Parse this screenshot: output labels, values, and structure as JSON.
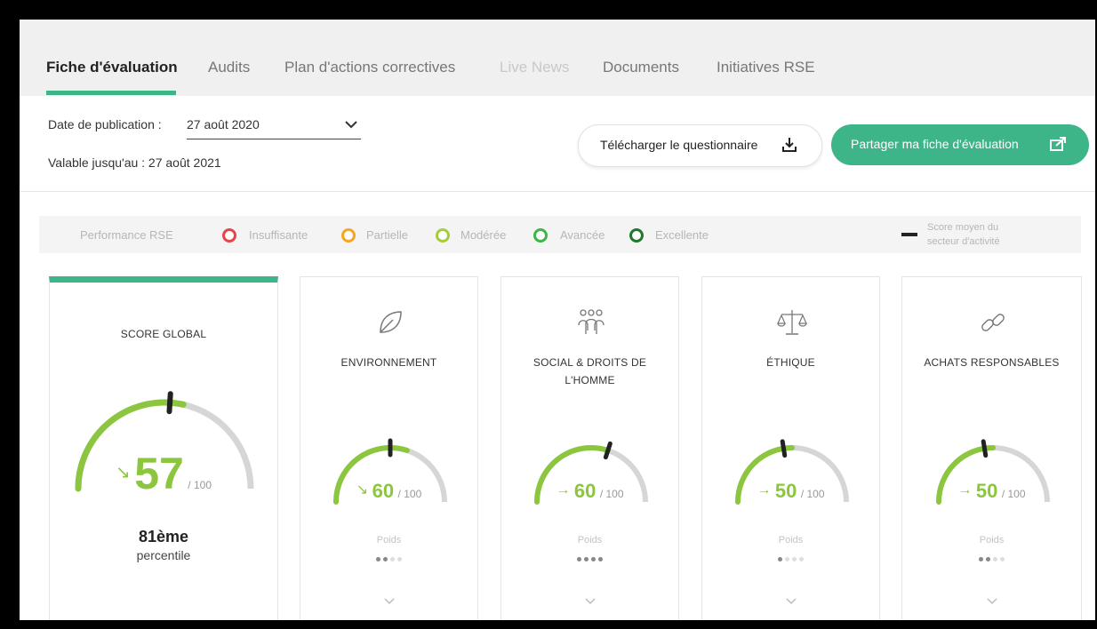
{
  "tabs": [
    {
      "label": "Fiche d'évaluation",
      "state": "active"
    },
    {
      "label": "Audits",
      "state": "normal"
    },
    {
      "label": "Plan d'actions correctives",
      "state": "normal"
    },
    {
      "label": "Live News",
      "state": "disabled"
    },
    {
      "label": "Documents",
      "state": "normal"
    },
    {
      "label": "Initiatives RSE",
      "state": "normal"
    }
  ],
  "publication": {
    "label": "Date de publication :",
    "value": "27 août 2020",
    "valid_until": "Valable jusqu'au : 27 août 2021"
  },
  "actions": {
    "download_label": "Télécharger le questionnaire",
    "share_label": "Partager ma fiche d'évaluation"
  },
  "legend": {
    "title": "Performance RSE",
    "levels": [
      {
        "label": "Insuffisante",
        "color": "#e8434b"
      },
      {
        "label": "Partielle",
        "color": "#f5a623"
      },
      {
        "label": "Modérée",
        "color": "#a4cd39"
      },
      {
        "label": "Avancée",
        "color": "#3eb449"
      },
      {
        "label": "Excellente",
        "color": "#1f7a2e"
      }
    ],
    "average_line1": "Score moyen du",
    "average_line2": "secteur d'activité"
  },
  "colors": {
    "accent": "#3eb489",
    "gauge_fill": "#8cc63f",
    "gauge_track": "#d6d6d6"
  },
  "global": {
    "title": "SCORE GLOBAL",
    "score": "57",
    "max": "/ 100",
    "trend": "↘",
    "sector_average": 52,
    "percentile_value": "81ème",
    "percentile_label": "percentile"
  },
  "categories": [
    {
      "title_line1": "ENVIRONNEMENT",
      "title_line2": "",
      "icon": "leaf-icon",
      "score": "60",
      "max": "/ 100",
      "trend": "↘",
      "sector_average": 50,
      "poids_label": "Poids",
      "weight": 2
    },
    {
      "title_line1": "SOCIAL & DROITS DE",
      "title_line2": "L'HOMME",
      "icon": "people-icon",
      "score": "60",
      "max": "/ 100",
      "trend": "→",
      "sector_average": 60,
      "poids_label": "Poids",
      "weight": 4
    },
    {
      "title_line1": "ÉTHIQUE",
      "title_line2": "",
      "icon": "scales-icon",
      "score": "50",
      "max": "/ 100",
      "trend": "→",
      "sector_average": 45,
      "poids_label": "Poids",
      "weight": 1
    },
    {
      "title_line1": "ACHATS RESPONSABLES",
      "title_line2": "",
      "icon": "link-icon",
      "score": "50",
      "max": "/ 100",
      "trend": "→",
      "sector_average": 45,
      "poids_label": "Poids",
      "weight": 2
    }
  ]
}
